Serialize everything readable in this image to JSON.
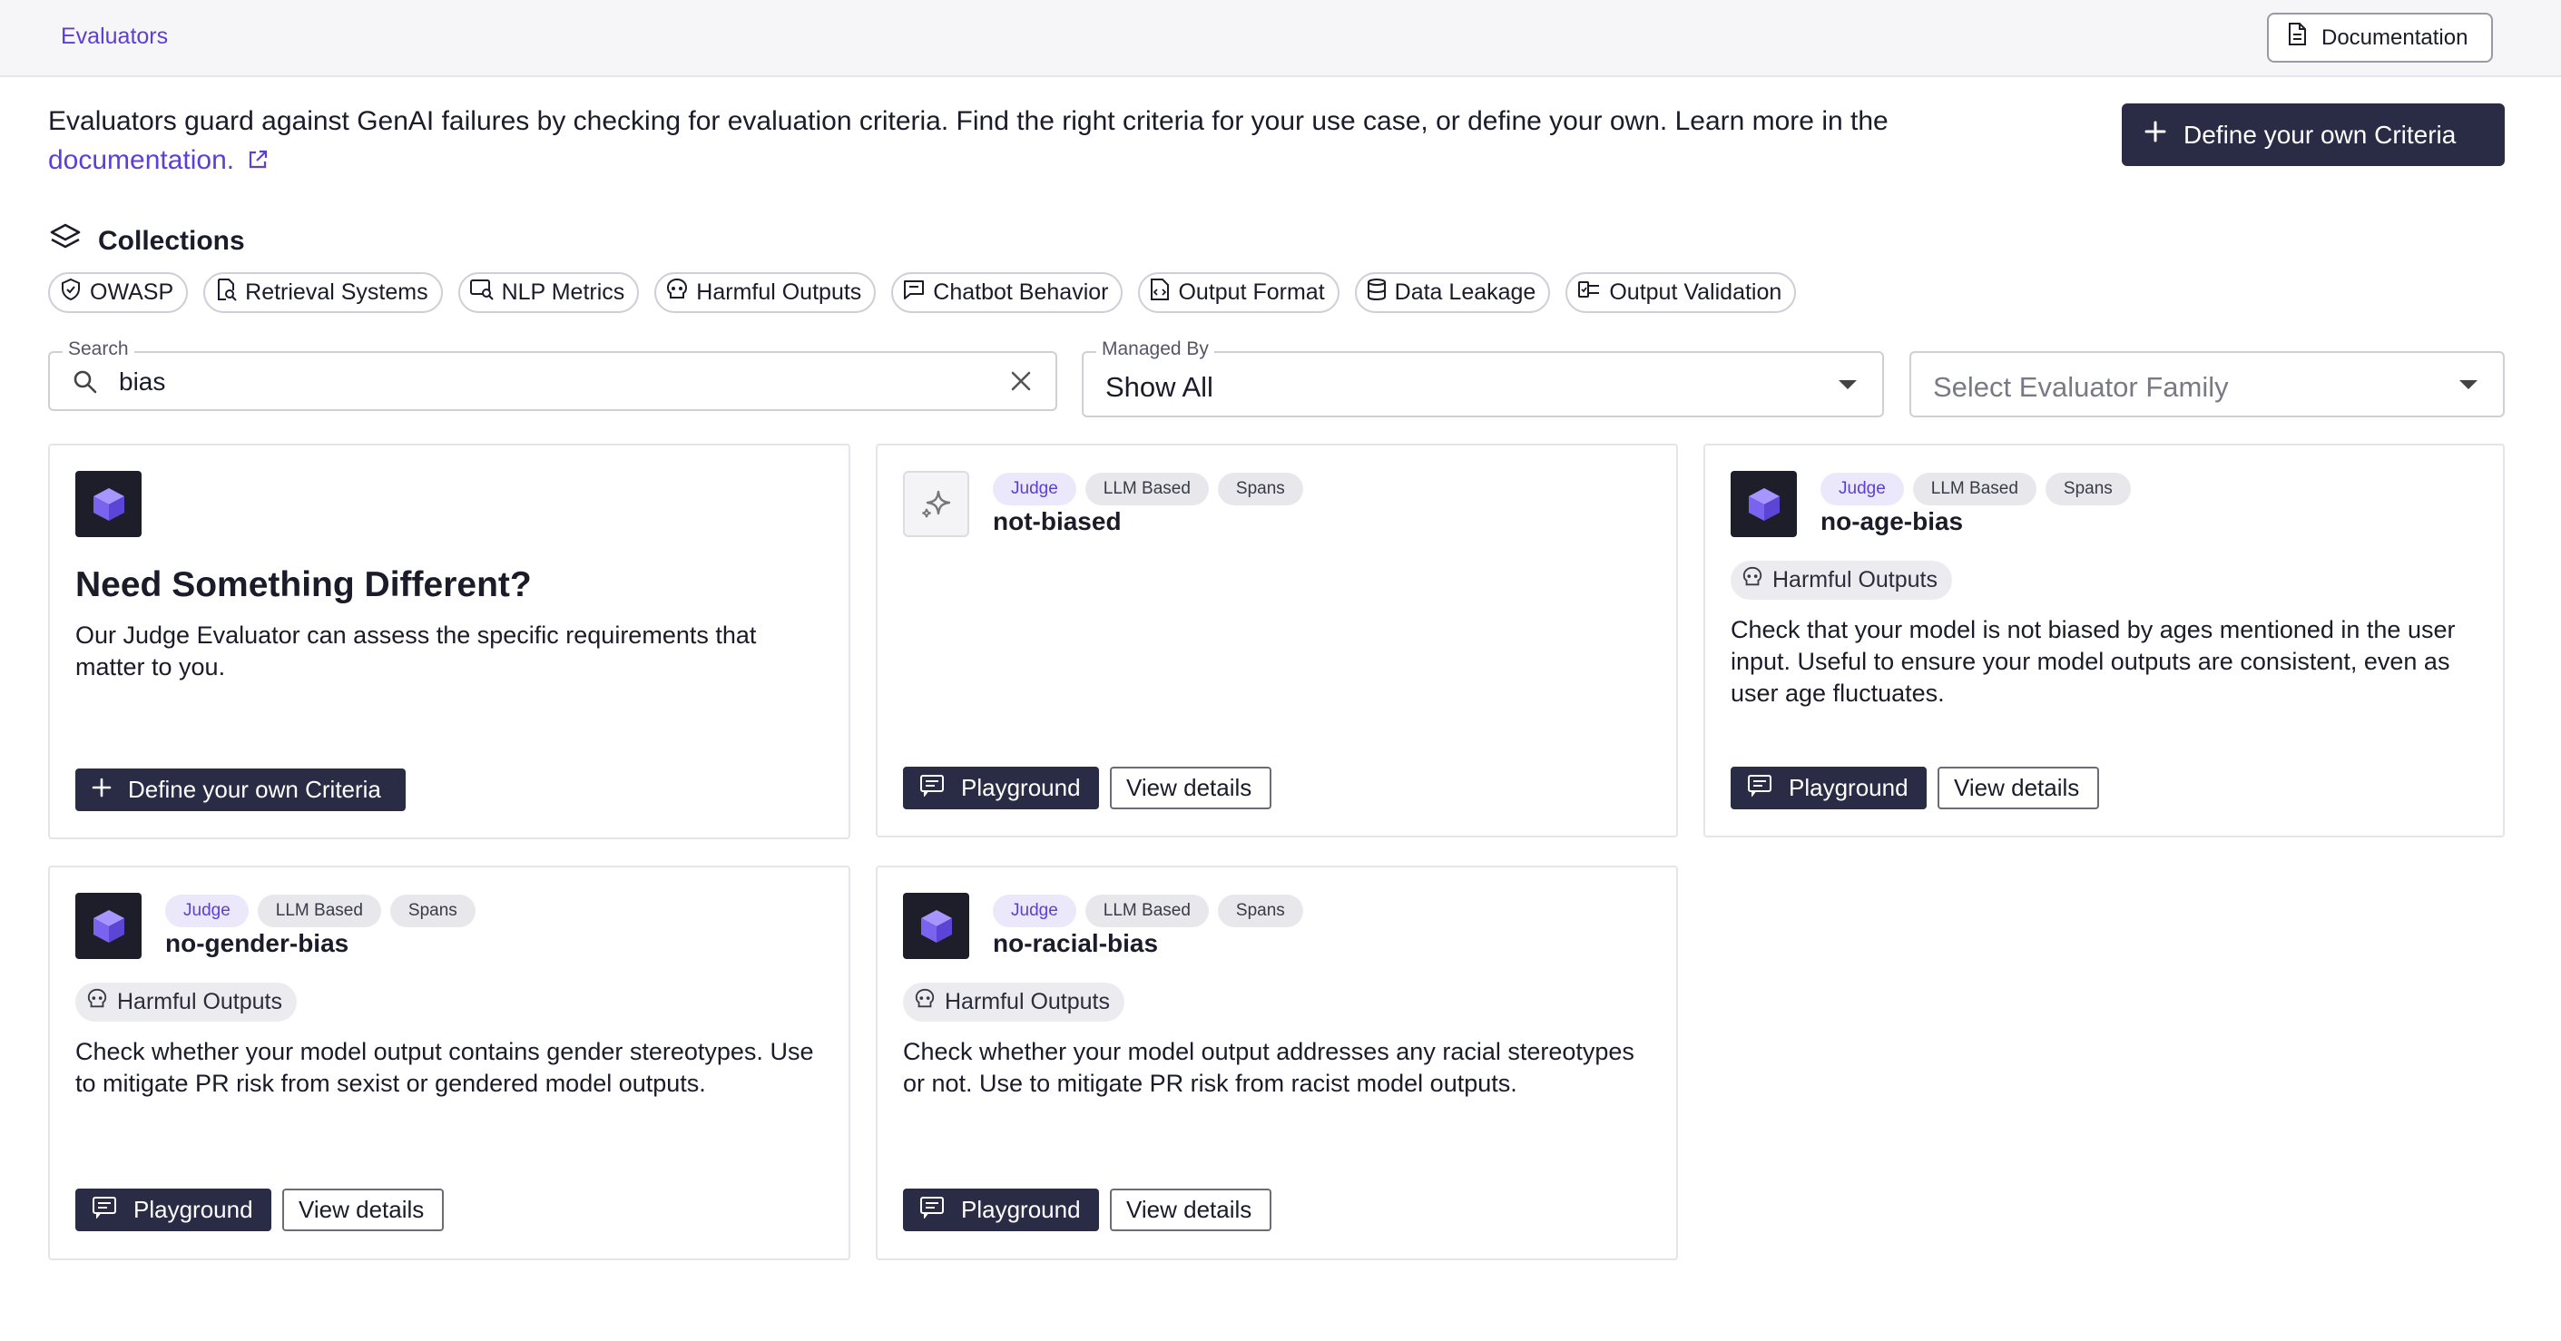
{
  "header": {
    "breadcrumb": "Evaluators",
    "documentation_label": "Documentation"
  },
  "intro": {
    "text": "Evaluators guard against GenAI failures by checking for evaluation criteria. Find the right criteria for your use case, or define your own. Learn more in the",
    "link": "documentation.",
    "define_button": "Define your own Criteria"
  },
  "collections": {
    "title": "Collections",
    "items": [
      {
        "label": "OWASP",
        "icon": "shield-icon"
      },
      {
        "label": "Retrieval Systems",
        "icon": "doc-search-icon"
      },
      {
        "label": "NLP Metrics",
        "icon": "sql-search-icon"
      },
      {
        "label": "Harmful Outputs",
        "icon": "skull-icon"
      },
      {
        "label": "Chatbot Behavior",
        "icon": "chat-icon"
      },
      {
        "label": "Output Format",
        "icon": "file-code-icon"
      },
      {
        "label": "Data Leakage",
        "icon": "database-icon"
      },
      {
        "label": "Output Validation",
        "icon": "validation-icon"
      }
    ]
  },
  "filters": {
    "search_label": "Search",
    "search_value": "bias",
    "managed_label": "Managed By",
    "managed_value": "Show All",
    "family_placeholder": "Select Evaluator Family"
  },
  "custom_card": {
    "title": "Need Something Different?",
    "description": "Our Judge Evaluator can assess the specific requirements that matter to you.",
    "button": "Define your own Criteria"
  },
  "evaluators": [
    {
      "name": "not-biased",
      "tags": [
        "Judge",
        "LLM Based",
        "Spans"
      ],
      "icon": "sparkle-icon",
      "family": "",
      "description": ""
    },
    {
      "name": "no-age-bias",
      "tags": [
        "Judge",
        "LLM Based",
        "Spans"
      ],
      "icon": "cube-icon",
      "family": "Harmful Outputs",
      "description": "Check that your model is not biased by ages mentioned in the user input. Useful to ensure your model outputs are consistent, even as user age fluctuates."
    },
    {
      "name": "no-gender-bias",
      "tags": [
        "Judge",
        "LLM Based",
        "Spans"
      ],
      "icon": "cube-icon",
      "family": "Harmful Outputs",
      "description": "Check whether your model output contains gender stereotypes. Use to mitigate PR risk from sexist or gendered model outputs."
    },
    {
      "name": "no-racial-bias",
      "tags": [
        "Judge",
        "LLM Based",
        "Spans"
      ],
      "icon": "cube-icon",
      "family": "Harmful Outputs",
      "description": "Check whether your model output addresses any racial stereotypes or not. Use to mitigate PR risk from racist model outputs."
    }
  ],
  "card_actions": {
    "playground": "Playground",
    "view_details": "View details"
  },
  "colors": {
    "accent": "#5b3fd6",
    "primary_button": "#2a2b45",
    "judge_tag_bg": "#ece8fb"
  }
}
